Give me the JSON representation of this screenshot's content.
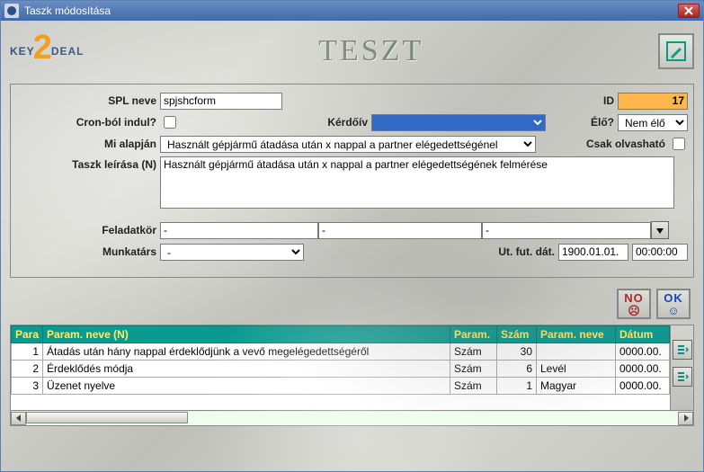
{
  "window": {
    "title": "Taszk módosítása"
  },
  "brand": {
    "logo_left": "KEY",
    "logo_num": "2",
    "logo_right": "DEAL",
    "main": "TESZT"
  },
  "labels": {
    "spl": "SPL neve",
    "id": "ID",
    "cron": "Cron-ból indul?",
    "kerdoiv": "Kérdőív",
    "elo": "Élő?",
    "mialapjan": "Mi alapján",
    "csak": "Csak olvasható",
    "leiras": "Taszk leírása (N)",
    "feladatkor": "Feladatkör",
    "munkatars": "Munkatárs",
    "utfut": "Ut. fut. dát."
  },
  "values": {
    "spl": "spjshcform",
    "id": "17",
    "kerdoiv": "",
    "elo": "Nem élő",
    "mialapjan": "Használt gépjármű átadása után x nappal a partner elégedettségénel",
    "leiras": "Használt gépjármű átadása után x nappal a partner elégedettségének felmérése",
    "feladat1": "-",
    "feladat2": "-",
    "feladat3": "-",
    "munkatars": "-",
    "utfut_date": "1900.01.01.",
    "utfut_time": "00:00:00"
  },
  "buttons": {
    "no": "NO",
    "ok": "OK"
  },
  "table": {
    "headers": {
      "para": "Para",
      "nev": "Param. neve (N)",
      "param": "Param.",
      "szam": "Szám",
      "pneve": "Param. neve",
      "datum": "Dátum"
    },
    "rows": [
      {
        "idx": "1",
        "nev": "Átadás után hány nappal érdeklődjünk a vevő megelégedettségéről",
        "param": "Szám",
        "szam": "30",
        "pneve": "",
        "datum": "0000.00."
      },
      {
        "idx": "2",
        "nev": "Érdeklődés módja",
        "param": "Szám",
        "szam": "6",
        "pneve": "Levél",
        "datum": "0000.00."
      },
      {
        "idx": "3",
        "nev": "Üzenet nyelve",
        "param": "Szám",
        "szam": "1",
        "pneve": "Magyar",
        "datum": "0000.00."
      }
    ]
  }
}
